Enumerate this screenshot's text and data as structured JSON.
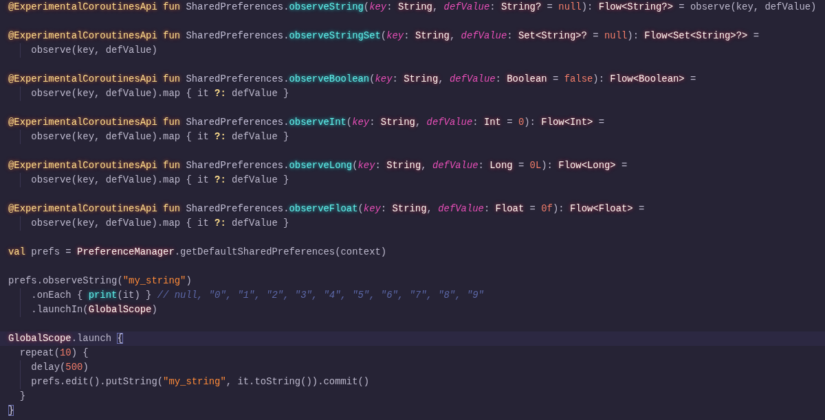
{
  "blocks": [
    {
      "lines": [
        {
          "current": false,
          "tokens": [
            {
              "kind": "annotation",
              "text": "@ExperimentalCoroutinesApi"
            },
            {
              "kind": "keyword",
              "text": " fun "
            },
            {
              "kind": "receiver",
              "text": "SharedPreferences."
            },
            {
              "kind": "function",
              "text": "observeString"
            },
            {
              "kind": "plain",
              "text": "("
            },
            {
              "kind": "param",
              "text": "key"
            },
            {
              "kind": "plain",
              "text": ": "
            },
            {
              "kind": "type",
              "text": "String"
            },
            {
              "kind": "plain",
              "text": ", "
            },
            {
              "kind": "param",
              "text": "defValue"
            },
            {
              "kind": "plain",
              "text": ": "
            },
            {
              "kind": "type",
              "text": "String?"
            },
            {
              "kind": "plain",
              "text": " = "
            },
            {
              "kind": "literal",
              "text": "null"
            },
            {
              "kind": "plain",
              "text": "): "
            },
            {
              "kind": "type",
              "text": "Flow<String?>"
            },
            {
              "kind": "plain",
              "text": " = observe(key, defValue)"
            }
          ]
        }
      ]
    },
    {
      "lines": [
        {
          "current": false,
          "tokens": [
            {
              "kind": "annotation",
              "text": "@ExperimentalCoroutinesApi"
            },
            {
              "kind": "keyword",
              "text": " fun "
            },
            {
              "kind": "receiver",
              "text": "SharedPreferences."
            },
            {
              "kind": "function",
              "text": "observeStringSet"
            },
            {
              "kind": "plain",
              "text": "("
            },
            {
              "kind": "param",
              "text": "key"
            },
            {
              "kind": "plain",
              "text": ": "
            },
            {
              "kind": "type",
              "text": "String"
            },
            {
              "kind": "plain",
              "text": ", "
            },
            {
              "kind": "param",
              "text": "defValue"
            },
            {
              "kind": "plain",
              "text": ": "
            },
            {
              "kind": "type",
              "text": "Set<String>?"
            },
            {
              "kind": "plain",
              "text": " = "
            },
            {
              "kind": "literal",
              "text": "null"
            },
            {
              "kind": "plain",
              "text": "): "
            },
            {
              "kind": "type",
              "text": "Flow<Set<String>?>"
            },
            {
              "kind": "plain",
              "text": " ="
            }
          ]
        },
        {
          "current": false,
          "tokens": [
            {
              "kind": "plain",
              "text": "    observe(key, defValue)"
            }
          ]
        }
      ]
    },
    {
      "lines": [
        {
          "current": false,
          "tokens": [
            {
              "kind": "annotation",
              "text": "@ExperimentalCoroutinesApi"
            },
            {
              "kind": "keyword",
              "text": " fun "
            },
            {
              "kind": "receiver",
              "text": "SharedPreferences."
            },
            {
              "kind": "function",
              "text": "observeBoolean"
            },
            {
              "kind": "plain",
              "text": "("
            },
            {
              "kind": "param",
              "text": "key"
            },
            {
              "kind": "plain",
              "text": ": "
            },
            {
              "kind": "type",
              "text": "String"
            },
            {
              "kind": "plain",
              "text": ", "
            },
            {
              "kind": "param",
              "text": "defValue"
            },
            {
              "kind": "plain",
              "text": ": "
            },
            {
              "kind": "type",
              "text": "Boolean"
            },
            {
              "kind": "plain",
              "text": " = "
            },
            {
              "kind": "literal",
              "text": "false"
            },
            {
              "kind": "plain",
              "text": "): "
            },
            {
              "kind": "type",
              "text": "Flow<Boolean>"
            },
            {
              "kind": "plain",
              "text": " ="
            }
          ]
        },
        {
          "current": false,
          "tokens": [
            {
              "kind": "plain",
              "text": "    observe(key, defValue).map { it "
            },
            {
              "kind": "operator",
              "text": "?:"
            },
            {
              "kind": "plain",
              "text": " defValue }"
            }
          ]
        }
      ]
    },
    {
      "lines": [
        {
          "current": false,
          "tokens": [
            {
              "kind": "annotation",
              "text": "@ExperimentalCoroutinesApi"
            },
            {
              "kind": "keyword",
              "text": " fun "
            },
            {
              "kind": "receiver",
              "text": "SharedPreferences."
            },
            {
              "kind": "function",
              "text": "observeInt"
            },
            {
              "kind": "plain",
              "text": "("
            },
            {
              "kind": "param",
              "text": "key"
            },
            {
              "kind": "plain",
              "text": ": "
            },
            {
              "kind": "type",
              "text": "String"
            },
            {
              "kind": "plain",
              "text": ", "
            },
            {
              "kind": "param",
              "text": "defValue"
            },
            {
              "kind": "plain",
              "text": ": "
            },
            {
              "kind": "type",
              "text": "Int"
            },
            {
              "kind": "plain",
              "text": " = "
            },
            {
              "kind": "literal",
              "text": "0"
            },
            {
              "kind": "plain",
              "text": "): "
            },
            {
              "kind": "type",
              "text": "Flow<Int>"
            },
            {
              "kind": "plain",
              "text": " ="
            }
          ]
        },
        {
          "current": false,
          "tokens": [
            {
              "kind": "plain",
              "text": "    observe(key, defValue).map { it "
            },
            {
              "kind": "operator",
              "text": "?:"
            },
            {
              "kind": "plain",
              "text": " defValue }"
            }
          ]
        }
      ]
    },
    {
      "lines": [
        {
          "current": false,
          "tokens": [
            {
              "kind": "annotation",
              "text": "@ExperimentalCoroutinesApi"
            },
            {
              "kind": "keyword",
              "text": " fun "
            },
            {
              "kind": "receiver",
              "text": "SharedPreferences."
            },
            {
              "kind": "function",
              "text": "observeLong"
            },
            {
              "kind": "plain",
              "text": "("
            },
            {
              "kind": "param",
              "text": "key"
            },
            {
              "kind": "plain",
              "text": ": "
            },
            {
              "kind": "type",
              "text": "String"
            },
            {
              "kind": "plain",
              "text": ", "
            },
            {
              "kind": "param",
              "text": "defValue"
            },
            {
              "kind": "plain",
              "text": ": "
            },
            {
              "kind": "type",
              "text": "Long"
            },
            {
              "kind": "plain",
              "text": " = "
            },
            {
              "kind": "literal",
              "text": "0L"
            },
            {
              "kind": "plain",
              "text": "): "
            },
            {
              "kind": "type",
              "text": "Flow<Long>"
            },
            {
              "kind": "plain",
              "text": " ="
            }
          ]
        },
        {
          "current": false,
          "tokens": [
            {
              "kind": "plain",
              "text": "    observe(key, defValue).map { it "
            },
            {
              "kind": "operator",
              "text": "?:"
            },
            {
              "kind": "plain",
              "text": " defValue }"
            }
          ]
        }
      ]
    },
    {
      "lines": [
        {
          "current": false,
          "tokens": [
            {
              "kind": "annotation",
              "text": "@ExperimentalCoroutinesApi"
            },
            {
              "kind": "keyword",
              "text": " fun "
            },
            {
              "kind": "receiver",
              "text": "SharedPreferences."
            },
            {
              "kind": "function",
              "text": "observeFloat"
            },
            {
              "kind": "plain",
              "text": "("
            },
            {
              "kind": "param",
              "text": "key"
            },
            {
              "kind": "plain",
              "text": ": "
            },
            {
              "kind": "type",
              "text": "String"
            },
            {
              "kind": "plain",
              "text": ", "
            },
            {
              "kind": "param",
              "text": "defValue"
            },
            {
              "kind": "plain",
              "text": ": "
            },
            {
              "kind": "type",
              "text": "Float"
            },
            {
              "kind": "plain",
              "text": " = "
            },
            {
              "kind": "literal",
              "text": "0f"
            },
            {
              "kind": "plain",
              "text": "): "
            },
            {
              "kind": "type",
              "text": "Flow<Float>"
            },
            {
              "kind": "plain",
              "text": " ="
            }
          ]
        },
        {
          "current": false,
          "tokens": [
            {
              "kind": "plain",
              "text": "    observe(key, defValue).map { it "
            },
            {
              "kind": "operator",
              "text": "?:"
            },
            {
              "kind": "plain",
              "text": " defValue }"
            }
          ]
        }
      ]
    },
    {
      "lines": [
        {
          "current": false,
          "tokens": [
            {
              "kind": "keyword",
              "text": "val"
            },
            {
              "kind": "plain",
              "text": " prefs = "
            },
            {
              "kind": "type",
              "text": "PreferenceManager"
            },
            {
              "kind": "plain",
              "text": ".getDefaultSharedPreferences(context)"
            }
          ]
        }
      ]
    },
    {
      "lines": [
        {
          "current": false,
          "tokens": [
            {
              "kind": "plain",
              "text": "prefs.observeString("
            },
            {
              "kind": "string",
              "text": "\"my_string\""
            },
            {
              "kind": "plain",
              "text": ")"
            }
          ]
        },
        {
          "current": false,
          "tokens": [
            {
              "kind": "plain",
              "text": "    .onEach { "
            },
            {
              "kind": "function",
              "text": "print"
            },
            {
              "kind": "plain",
              "text": "(it) } "
            },
            {
              "kind": "comment",
              "text": "// null, \"0\", \"1\", \"2\", \"3\", \"4\", \"5\", \"6\", \"7\", \"8\", \"9\""
            }
          ]
        },
        {
          "current": false,
          "tokens": [
            {
              "kind": "plain",
              "text": "    .launchIn("
            },
            {
              "kind": "type",
              "text": "GlobalScope"
            },
            {
              "kind": "plain",
              "text": ")"
            }
          ]
        }
      ]
    },
    {
      "lines": [
        {
          "current": true,
          "tokens": [
            {
              "kind": "type",
              "text": "GlobalScope"
            },
            {
              "kind": "plain",
              "text": ".launch "
            },
            {
              "kind": "bracket",
              "text": "{"
            }
          ]
        },
        {
          "current": false,
          "tokens": [
            {
              "kind": "plain",
              "text": "  repeat("
            },
            {
              "kind": "literal",
              "text": "10"
            },
            {
              "kind": "plain",
              "text": ") {"
            }
          ]
        },
        {
          "current": false,
          "tokens": [
            {
              "kind": "plain",
              "text": "    delay("
            },
            {
              "kind": "literal",
              "text": "500"
            },
            {
              "kind": "plain",
              "text": ")"
            }
          ]
        },
        {
          "current": false,
          "tokens": [
            {
              "kind": "plain",
              "text": "    prefs.edit().putString("
            },
            {
              "kind": "string",
              "text": "\"my_string\""
            },
            {
              "kind": "plain",
              "text": ", it.toString()).commit()"
            }
          ]
        },
        {
          "current": false,
          "tokens": [
            {
              "kind": "plain",
              "text": "  }"
            }
          ]
        },
        {
          "current": false,
          "tokens": [
            {
              "kind": "bracket",
              "text": "}"
            }
          ]
        }
      ]
    }
  ]
}
